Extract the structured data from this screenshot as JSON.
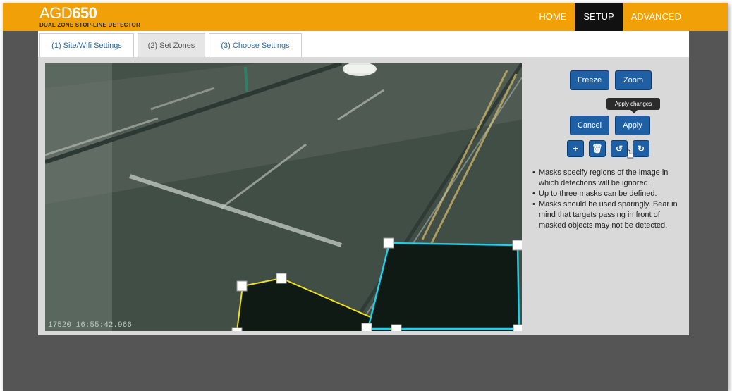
{
  "brand": {
    "name_light": "AGD",
    "name_bold": "650",
    "subtitle": "DUAL ZONE STOP-LINE DETECTOR"
  },
  "nav": {
    "items": [
      {
        "label": "HOME"
      },
      {
        "label": "SETUP",
        "active": true
      },
      {
        "label": "ADVANCED"
      }
    ]
  },
  "tabs": [
    {
      "label": "(1) Site/Wifi Settings"
    },
    {
      "label": "(2) Set Zones",
      "active": true
    },
    {
      "label": "(3) Choose Settings"
    }
  ],
  "camera": {
    "timestamp": "17520  16:55:42.966"
  },
  "buttons": {
    "freeze": "Freeze",
    "zoom": "Zoom",
    "cancel": "Cancel",
    "apply": "Apply"
  },
  "icon_buttons": [
    {
      "icon": "plus-icon",
      "glyph": "+"
    },
    {
      "icon": "trash-icon",
      "glyph": "🗑"
    },
    {
      "icon": "undo-icon",
      "glyph": "↺"
    },
    {
      "icon": "redo-icon",
      "glyph": "↻"
    }
  ],
  "tooltip": "Apply changes",
  "info": [
    "Masks specify regions of the image in which detections will be ignored.",
    "Up to three masks can be defined.",
    "Masks should be used sparingly. Bear in mind that targets passing in front of masked objects may not be detected."
  ],
  "colors": {
    "accent": "#f2a007",
    "button": "#1f5fa4",
    "mask_yellow": "#f0e11a",
    "mask_cyan": "#22cfe6"
  }
}
